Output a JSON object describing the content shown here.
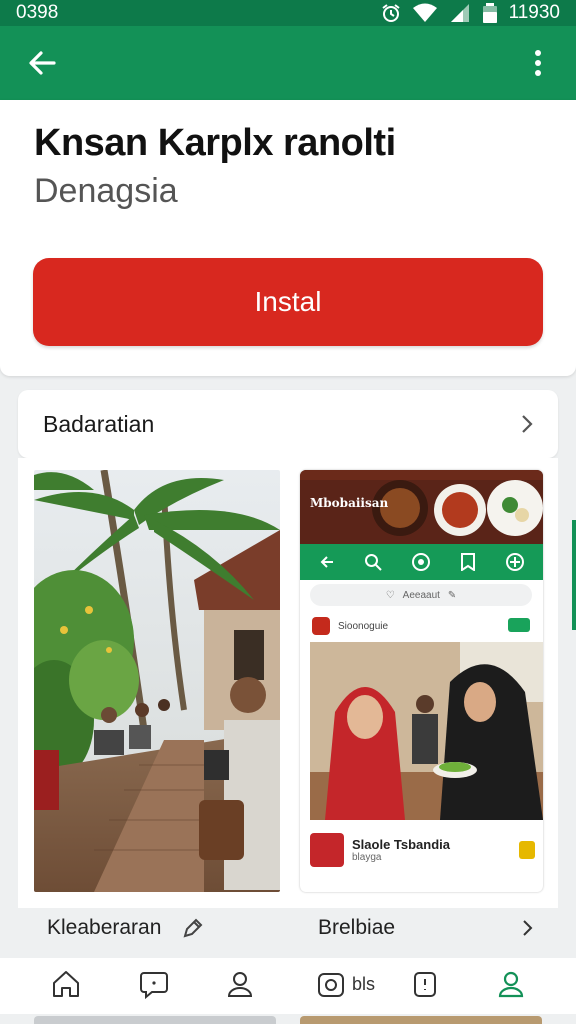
{
  "status_bar": {
    "left_text": "0398",
    "time": "11930"
  },
  "app": {
    "title": "Knsan Karplx ranolti",
    "subtitle": "Denagsia",
    "install_label": "Instal"
  },
  "section": {
    "label": "Badaratian"
  },
  "screenshots": {
    "right": {
      "banner_text": "Mbobaiisan",
      "search_text": "Aeeaaut",
      "post_header": "Sioonoguie",
      "author_name": "Slaole Tsbandia",
      "author_sub": "blayga"
    }
  },
  "captions": {
    "left": "Kleaberaran",
    "right": "Brelbiae"
  },
  "bottom_nav": {
    "item2_label": "bls"
  },
  "colors": {
    "primary_green": "#139157",
    "status_green": "#0d7a4a",
    "install_red": "#d8281f"
  },
  "icons": [
    "back-arrow-icon",
    "more-vert-icon",
    "chevron-right-icon",
    "home-icon",
    "chat-icon",
    "profile-icon",
    "camera-icon",
    "clipboard-icon",
    "wifi-icon",
    "signal-icon",
    "battery-icon",
    "alarm-icon"
  ]
}
